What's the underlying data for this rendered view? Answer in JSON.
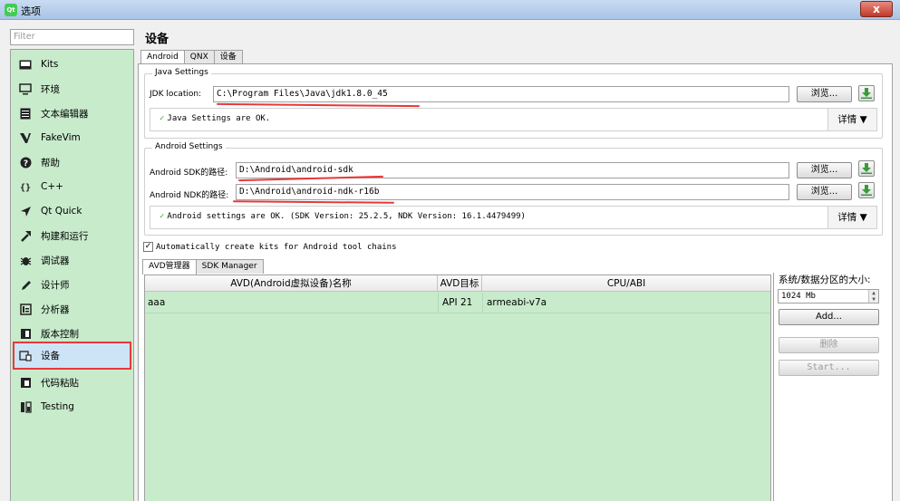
{
  "window": {
    "title": "选项",
    "close_glyph": "x"
  },
  "filter": {
    "placeholder": "Filter"
  },
  "sidebar": {
    "items": [
      {
        "label": "Kits",
        "icon": "kits-icon"
      },
      {
        "label": "环境",
        "icon": "monitor-icon"
      },
      {
        "label": "文本编辑器",
        "icon": "text-editor-icon"
      },
      {
        "label": "FakeVim",
        "icon": "fakevim-icon"
      },
      {
        "label": "帮助",
        "icon": "help-icon"
      },
      {
        "label": "C++",
        "icon": "cpp-braces-icon"
      },
      {
        "label": "Qt Quick",
        "icon": "qt-quick-icon"
      },
      {
        "label": "构建和运行",
        "icon": "build-run-icon"
      },
      {
        "label": "调试器",
        "icon": "debugger-icon"
      },
      {
        "label": "设计师",
        "icon": "designer-icon"
      },
      {
        "label": "分析器",
        "icon": "analyzer-icon"
      },
      {
        "label": "版本控制",
        "icon": "version-control-icon"
      },
      {
        "label": "设备",
        "icon": "device-icon",
        "selected": true
      },
      {
        "label": "代码粘贴",
        "icon": "code-paste-icon"
      },
      {
        "label": "Testing",
        "icon": "testing-icon"
      }
    ]
  },
  "page": {
    "title": "设备",
    "tabs": [
      {
        "label": "Android",
        "active": true
      },
      {
        "label": "QNX"
      },
      {
        "label": "设备"
      }
    ]
  },
  "java": {
    "group_title": "Java Settings",
    "jdk_label": "JDK location:",
    "jdk_value": "C:\\Program Files\\Java\\jdk1.8.0_45",
    "browse": "浏览...",
    "status": "Java Settings are OK.",
    "details": "详情 ▼"
  },
  "android": {
    "group_title": "Android Settings",
    "sdk_label": "Android SDK的路径:",
    "sdk_value": "D:\\Android\\android-sdk",
    "ndk_label": "Android NDK的路径:",
    "ndk_value": "D:\\Android\\android-ndk-r16b",
    "browse": "浏览...",
    "status": "Android settings are OK.  (SDK Version: 25.2.5, NDK Version: 16.1.4479499)",
    "details": "详情 ▼"
  },
  "auto_create": {
    "label": "Automatically create kits for Android tool chains",
    "checked": true
  },
  "lower_tabs": [
    {
      "label": "AVD管理器",
      "active": true
    },
    {
      "label": "SDK Manager"
    }
  ],
  "avd_table": {
    "columns": [
      "AVD(Android虚拟设备)名称",
      "AVD目标",
      "CPU/ABI"
    ],
    "rows": [
      {
        "name": "aaa",
        "target": "API 21",
        "abi": "armeabi-v7a"
      }
    ]
  },
  "avd_side": {
    "partition_label": "系统/数据分区的大小:",
    "partition_value": "1024 Mb",
    "add": "Add...",
    "delete": "删除",
    "start": "Start..."
  },
  "colors": {
    "sidebar_bg": "#c8ebcc",
    "selection_outline": "#e8383b",
    "ok_check": "#3aa83a",
    "download_arrow": "#3a9a3a"
  }
}
